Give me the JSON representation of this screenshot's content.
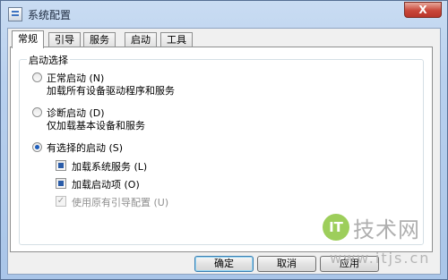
{
  "window": {
    "title": "系统配置",
    "close_glyph": "X"
  },
  "tabs": [
    {
      "label": "常规",
      "active": true
    },
    {
      "label": "引导"
    },
    {
      "label": "服务"
    },
    {
      "label": "启动"
    },
    {
      "label": "工具"
    }
  ],
  "startup_selection": {
    "group_title": "启动选择",
    "options": [
      {
        "label": "正常启动 (N)",
        "description": "加载所有设备驱动程序和服务",
        "selected": false
      },
      {
        "label": "诊断启动 (D)",
        "description": "仅加载基本设备和服务",
        "selected": false
      },
      {
        "label": "有选择的启动 (S)",
        "selected": true
      }
    ],
    "selective_items": [
      {
        "label": "加载系统服务 (L)",
        "state": "indeterminate"
      },
      {
        "label": "加载启动项 (O)",
        "state": "indeterminate"
      },
      {
        "label": "使用原有引导配置 (U)",
        "state": "checked",
        "disabled": true
      }
    ]
  },
  "buttons": {
    "ok": "确定",
    "cancel": "取消",
    "apply": "应用"
  },
  "watermark": {
    "logo_text": "IT",
    "name": "技术网",
    "url": "www.itjs.cn"
  }
}
